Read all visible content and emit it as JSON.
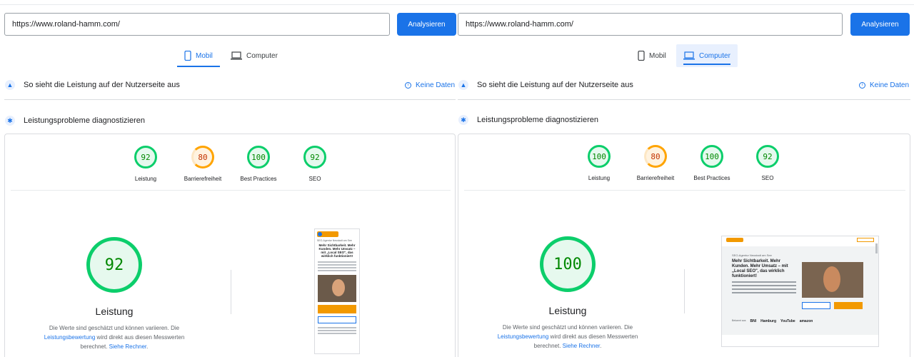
{
  "left": {
    "url_value": "https://www.roland-hamm.com/",
    "analyze_label": "Analysieren",
    "tabs": [
      {
        "label": "Mobil",
        "icon": "smartphone-icon",
        "active": true
      },
      {
        "label": "Computer",
        "icon": "laptop-icon",
        "active": false
      }
    ],
    "field_data": {
      "title": "So sieht die Leistung auf der Nutzerseite aus",
      "status": "Keine Daten"
    },
    "diagnose_title": "Leistungsprobleme diagnostizieren",
    "scores": [
      {
        "value": "92",
        "label": "Leistung",
        "rating": "good"
      },
      {
        "value": "80",
        "label": "Barrierefreiheit",
        "rating": "average"
      },
      {
        "value": "100",
        "label": "Best Practices",
        "rating": "good"
      },
      {
        "value": "92",
        "label": "SEO",
        "rating": "good"
      }
    ],
    "main_score": "92",
    "main_label": "Leistung",
    "desc_part1": "Die Werte sind geschätzt und können variieren. Die ",
    "desc_link1": "Leistungsbewertung",
    "desc_part2": " wird direkt aus diesen Messwerten berechnet. ",
    "desc_link2": "Siehe Rechner",
    "desc_end": "."
  },
  "right": {
    "url_value": "https://www.roland-hamm.com/",
    "analyze_label": "Analysieren",
    "tabs": [
      {
        "label": "Mobil",
        "icon": "smartphone-icon",
        "active": false
      },
      {
        "label": "Computer",
        "icon": "laptop-icon",
        "active": true
      }
    ],
    "field_data": {
      "title": "So sieht die Leistung auf der Nutzerseite aus",
      "status": "Keine Daten"
    },
    "diagnose_title": "Leistungsprobleme diagnostizieren",
    "scores": [
      {
        "value": "100",
        "label": "Leistung",
        "rating": "good"
      },
      {
        "value": "80",
        "label": "Barrierefreiheit",
        "rating": "average"
      },
      {
        "value": "100",
        "label": "Best Practices",
        "rating": "good"
      },
      {
        "value": "92",
        "label": "SEO",
        "rating": "good"
      }
    ],
    "main_score": "100",
    "main_label": "Leistung",
    "desc_part1": "Die Werte sind geschätzt und können variieren. Die ",
    "desc_link1": "Leistungsbewertung",
    "desc_part2": " wird direkt aus diesen Messwerten berechnet. ",
    "desc_link2": "Siehe Rechner",
    "desc_end": "."
  },
  "screenshot_mobile": {
    "subtitle": "SEO-Agentur Neustadt am See",
    "headline": "Mehr Sichtbarkeit. Mehr Kunden. Mehr Umsatz – mit „Local SEO\", das wirklich funktioniert!"
  },
  "screenshot_desktop": {
    "subtitle": "SEO-Agentur Neustadt am See",
    "headline": "Mehr Sichtbarkeit. Mehr Kunden. Mehr Umsatz – mit „Local SEO\", das wirklich funktioniert!",
    "logos": [
      "BNI",
      "Hamburg",
      "YouTube",
      "amazon"
    ],
    "logos_label": "Bekannt aus"
  },
  "colors": {
    "good": "#0cce6b",
    "average": "#ffa400",
    "accent": "#1a73e8"
  }
}
